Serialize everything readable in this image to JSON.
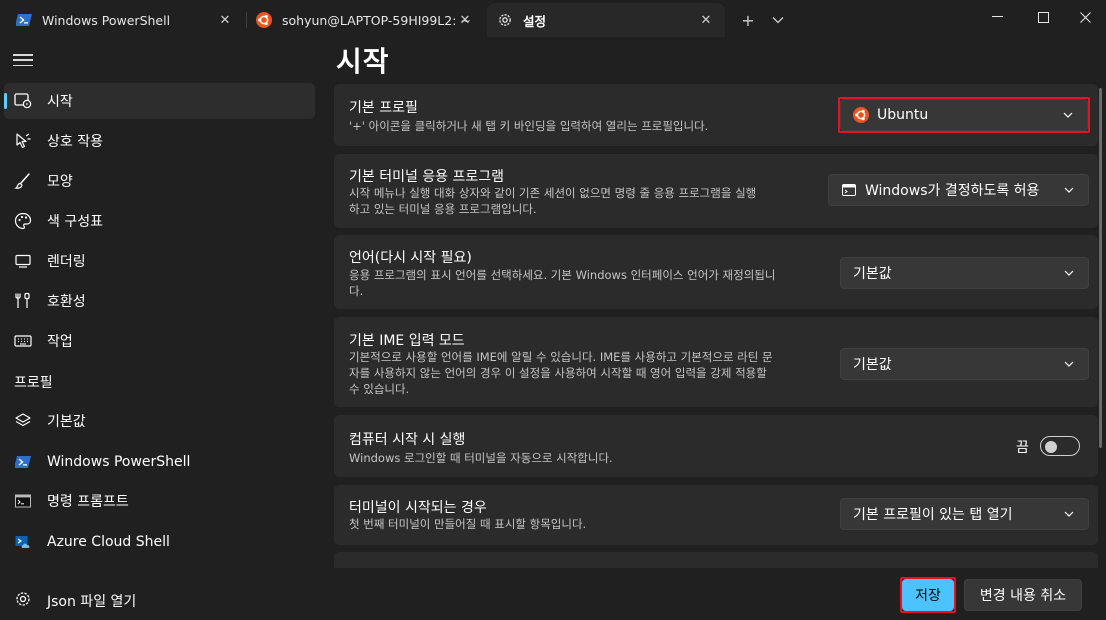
{
  "tabs": [
    {
      "title": "Windows PowerShell",
      "icon": "powershell-icon"
    },
    {
      "title": "sohyun@LAPTOP-59HI99L2: ~",
      "icon": "ubuntu-icon"
    },
    {
      "title": "설정",
      "icon": "gear-icon"
    }
  ],
  "tabbar": {
    "new_tab_label": "+",
    "dropdown_label": "⌄"
  },
  "sidebar": {
    "items": [
      {
        "label": "시작",
        "icon": "startup-icon"
      },
      {
        "label": "상호 작용",
        "icon": "pointer-icon"
      },
      {
        "label": "모양",
        "icon": "brush-icon"
      },
      {
        "label": "색 구성표",
        "icon": "palette-icon"
      },
      {
        "label": "렌더링",
        "icon": "monitor-icon"
      },
      {
        "label": "호환성",
        "icon": "tools-icon"
      },
      {
        "label": "작업",
        "icon": "keyboard-icon"
      }
    ],
    "profiles_header": "프로필",
    "profiles": [
      {
        "label": "기본값",
        "icon": "layers-icon"
      },
      {
        "label": "Windows PowerShell",
        "icon": "powershell-icon"
      },
      {
        "label": "명령 프롬프트",
        "icon": "cmd-icon"
      },
      {
        "label": "Azure Cloud Shell",
        "icon": "azure-icon"
      }
    ],
    "json_link": "Json 파일 열기"
  },
  "main": {
    "title": "시작",
    "settings": [
      {
        "title": "기본 프로필",
        "desc": [
          "'+' 아이콘을 클릭하거나 새 탭 키 바인딩을 입력하여 열리는 프로필입니다."
        ],
        "value": "Ubuntu"
      },
      {
        "title": "기본 터미널 응용 프로그램",
        "desc": [
          "시작 메뉴나 실행 대화 상자와 같이 기존 세션이 없으면 명령 줄 응용 프로그램을 실행",
          "하고 있는 터미널 응용 프로그램입니다."
        ],
        "value": "Windows가 결정하도록 허용"
      },
      {
        "title": "언어(다시 시작 필요)",
        "desc": [
          "응용 프로그램의 표시 언어를 선택하세요. 기본 Windows 인터페이스 언어가 재정의됩니",
          "다."
        ],
        "value": "기본값"
      },
      {
        "title": "기본 IME 입력 모드",
        "desc": [
          "기본적으로 사용할 언어를 IME에 알릴 수 있습니다. IME를 사용하고 기본적으로 라틴 문",
          "자를 사용하지 않는 언어의 경우 이 설정을 사용하여 시작할 때 영어 입력을 강제 적용할",
          "수 있습니다."
        ],
        "value": "기본값"
      },
      {
        "title": "컴퓨터 시작 시 실행",
        "desc": [
          "Windows 로그인할 때 터미널을 자동으로 시작합니다."
        ],
        "toggle_label": "끔",
        "toggle_on": false
      },
      {
        "title": "터미널이 시작되는 경우",
        "desc": [
          "첫 번째 터미널이 만들어질 때 표시할 항목입니다."
        ],
        "value": "기본 프로필이 있는 탭 열기"
      }
    ]
  },
  "footer": {
    "save_label": "저장",
    "discard_label": "변경 내용 취소"
  },
  "colors": {
    "accent": "#4cc2ff",
    "highlight": "#e81123",
    "ubuntu": "#e95420"
  }
}
